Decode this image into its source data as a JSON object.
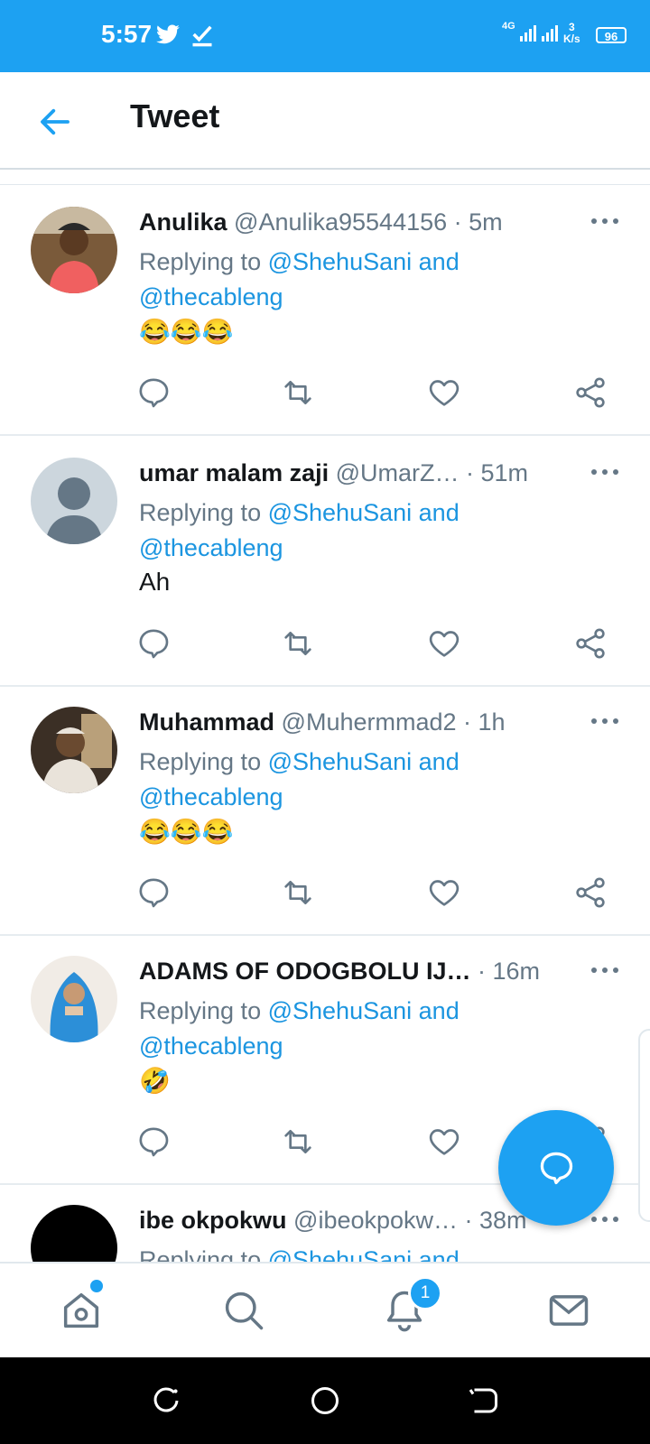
{
  "status_bar": {
    "time": "5:57",
    "network": "4G",
    "speed_value": "3",
    "speed_unit": "K/s",
    "battery": "96"
  },
  "header": {
    "title": "Tweet"
  },
  "tweets": [
    {
      "name": "Anulika",
      "meta": "@Anulika95544156 · 5m",
      "replying_prefix": "Replying to",
      "mention1": "@ShehuSani",
      "and": "and",
      "mention2": "@thecableng",
      "text": "😂😂😂"
    },
    {
      "name": "umar malam zaji",
      "meta": "@UmarZ… · 51m",
      "replying_prefix": "Replying to",
      "mention1": "@ShehuSani",
      "and": "and",
      "mention2": "@thecableng",
      "text": "Ah"
    },
    {
      "name": "Muhammad",
      "meta": "@Muhermmad2 · 1h",
      "replying_prefix": "Replying to",
      "mention1": "@ShehuSani",
      "and": "and",
      "mention2": "@thecableng",
      "text": "😂😂😂"
    },
    {
      "name": "ADAMS OF ODOGBOLU IJ…",
      "meta": "· 16m",
      "replying_prefix": "Replying to",
      "mention1": "@ShehuSani",
      "and": "and",
      "mention2": "@thecableng",
      "text": "🤣"
    },
    {
      "name": "ibe okpokwu",
      "meta": "@ibeokpokw… · 38m",
      "replying_prefix": "Replying to",
      "mention1": "@ShehuSani",
      "and": "and",
      "mention2": "",
      "text": ""
    }
  ],
  "bottom_nav": {
    "notifications_badge": "1"
  },
  "icons": [
    "twitter-bird-icon",
    "check-icon",
    "back-arrow-icon",
    "more-icon",
    "reply-icon",
    "retweet-icon",
    "like-icon",
    "share-icon",
    "compose-icon",
    "home-icon",
    "search-icon",
    "notifications-icon",
    "messages-icon"
  ],
  "colors": {
    "brand": "#1da1f2",
    "mention": "#1b95e0",
    "secondary_text": "#657786",
    "primary_text": "#14171a"
  }
}
